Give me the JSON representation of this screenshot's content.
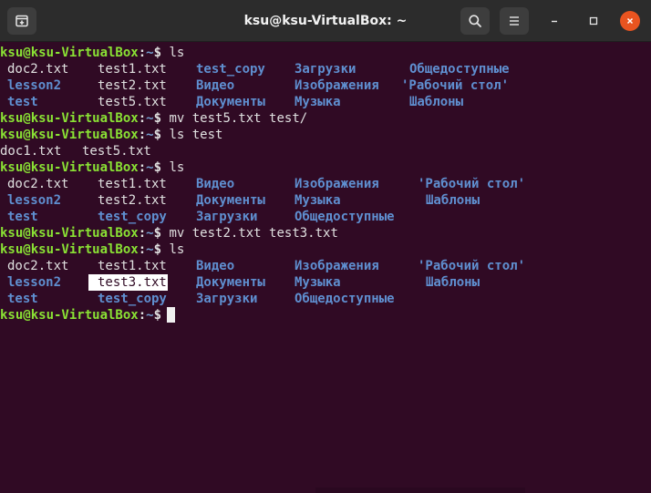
{
  "window": {
    "title": "ksu@ksu-VirtualBox: ~",
    "colors": {
      "background": "#300a24",
      "user": "#8ae234",
      "path": "#729fcf",
      "dir": "#5f8fd0",
      "close": "#e95420"
    }
  },
  "prompt": {
    "user_host": "ksu@ksu-VirtualBox",
    "sep": ":",
    "path": "~",
    "dollar": "$"
  },
  "commands": [
    "ls",
    "mv test5.txt test/",
    "ls test",
    "ls",
    "mv test2.txt test3.txt",
    "ls"
  ],
  "listing1": {
    "rows": [
      [
        "doc2.txt",
        "test1.txt",
        "test_copy",
        "Загрузки",
        "Общедоступные"
      ],
      [
        "lesson2",
        "test2.txt",
        "Видео",
        "Изображения",
        "'Рабочий стол'"
      ],
      [
        "test",
        "test5.txt",
        "Документы",
        "Музыка",
        "Шаблоны"
      ]
    ]
  },
  "listing_test": {
    "items": [
      "doc1.txt",
      "test5.txt"
    ]
  },
  "listing2": {
    "rows": [
      [
        "doc2.txt",
        "test1.txt",
        "Видео",
        "Изображения",
        "'Рабочий стол'"
      ],
      [
        "lesson2",
        "test2.txt",
        "Документы",
        "Музыка",
        "Шаблоны"
      ],
      [
        "test",
        "test_copy",
        "Загрузки",
        "Общедоступные"
      ]
    ]
  },
  "listing3": {
    "rows": [
      [
        "doc2.txt",
        "test1.txt",
        "Видео",
        "Изображения",
        "'Рабочий стол'"
      ],
      [
        "lesson2",
        "test3.txt",
        "Документы",
        "Музыка",
        "Шаблоны"
      ],
      [
        "test",
        "test_copy",
        "Загрузки",
        "Общедоступные"
      ]
    ]
  }
}
